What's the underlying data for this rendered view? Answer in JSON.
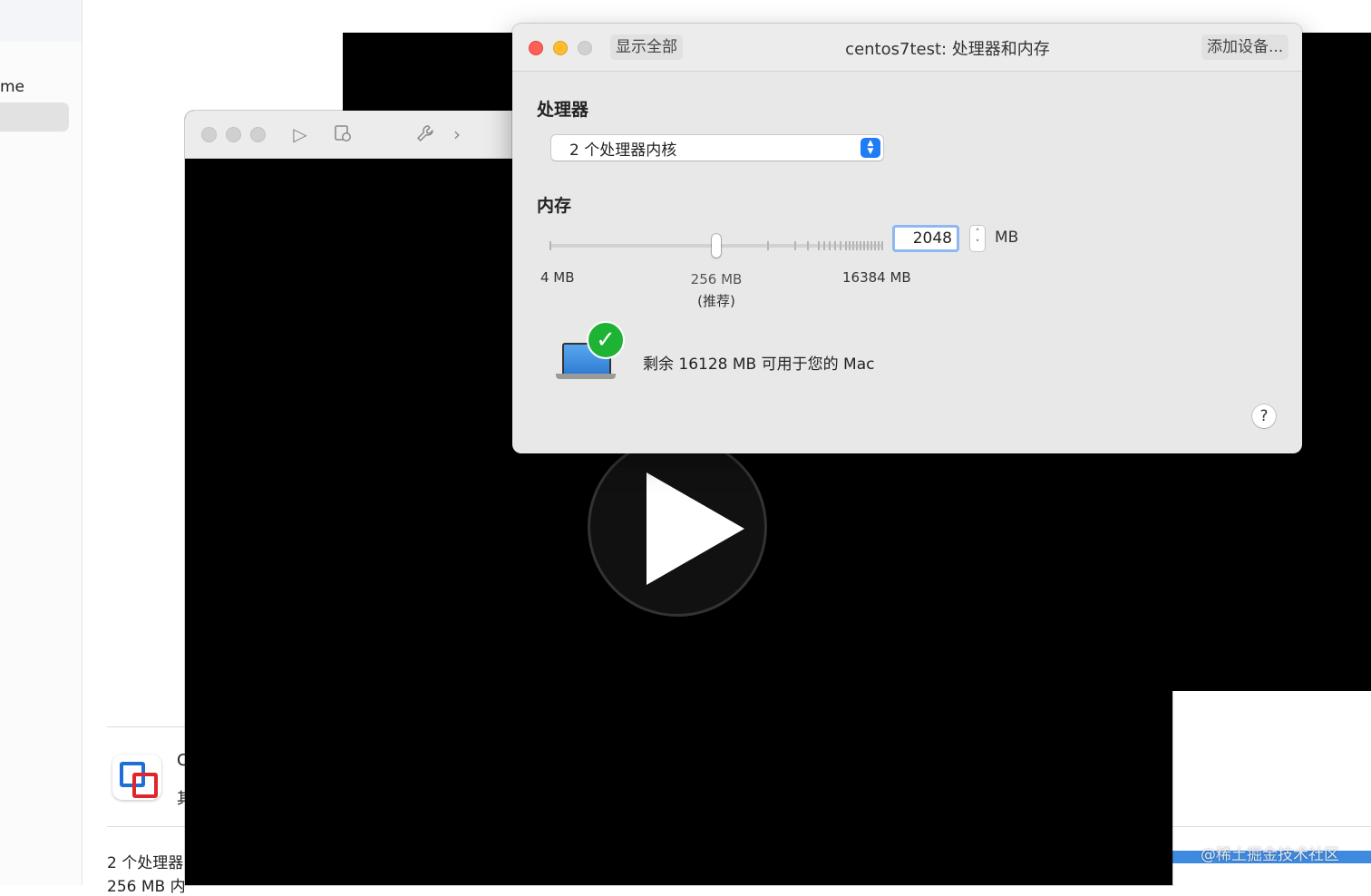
{
  "background_app": {
    "sidebar_label": "me",
    "row_title": "C",
    "row_subtitle": "其",
    "detail_line_1": "2 个处理器",
    "detail_line_2": "256 MB 内"
  },
  "vm_window": {
    "toolbar": {
      "play_icon": "play-icon",
      "snapshot_icon": "snapshot-icon",
      "wrench_icon": "wrench-icon",
      "chevron_icon": "chevron-right-icon"
    }
  },
  "dialog": {
    "title": "centos7test: 处理器和内存",
    "show_all_label": "显示全部",
    "add_device_label": "添加设备...",
    "processor": {
      "section_title": "处理器",
      "selected_option": "2 个处理器内核"
    },
    "memory": {
      "section_title": "内存",
      "value": "2048",
      "unit": "MB",
      "slider": {
        "min_label": "4 MB",
        "recommended_label": "256 MB",
        "recommended_sub": "(推荐)",
        "max_label": "16384 MB",
        "level_fraction": 0.5
      }
    },
    "status_text": "剩余 16128 MB 可用于您的 Mac",
    "help_label": "?"
  },
  "watermark": "@稀土掘金技术社区",
  "colors": {
    "accent_blue": "#1e7cf4",
    "close_red": "#fe5f57",
    "minimize_yellow": "#febc2e",
    "check_green": "#1fb335"
  }
}
